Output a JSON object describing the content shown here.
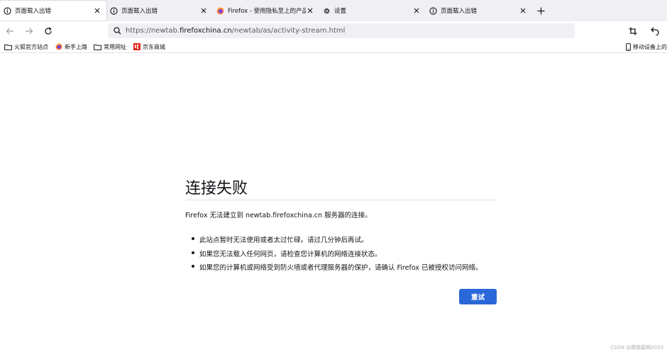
{
  "tabs": [
    {
      "title": "页面载入出错",
      "icon": "info-icon",
      "active": true
    },
    {
      "title": "页面载入出错",
      "icon": "info-icon",
      "active": false
    },
    {
      "title": "Firefox - 使用隐私至上的产品保护",
      "icon": "firefox-icon",
      "active": false
    },
    {
      "title": "设置",
      "icon": "gear-icon",
      "active": false
    },
    {
      "title": "页面载入出错",
      "icon": "info-icon",
      "active": false
    }
  ],
  "url": {
    "prefix": "https://newtab.",
    "host": "firefoxchina.cn",
    "path": "/newtab/as/activity-stream.html"
  },
  "bookmarks": {
    "items": [
      {
        "label": "火狐官方站点",
        "icon": "folder-icon"
      },
      {
        "label": "新手上路",
        "icon": "firefox-icon"
      },
      {
        "label": "常用网址",
        "icon": "folder-icon"
      },
      {
        "label": "京东商城",
        "icon": "jd-logo-icon"
      }
    ],
    "mobile": "移动设备上的"
  },
  "error": {
    "title": "连接失败",
    "description": "Firefox 无法建立到 newtab.firefoxchina.cn 服务器的连接。",
    "items": [
      "此站点暂时无法使用或者太过忙碌。请过几分钟后再试。",
      "如果您无法载入任何网页，请检查您计算机的网络连接状态。",
      "如果您的计算机或网络受到防火墙或者代理服务器的保护，请确认 Firefox 已被授权访问网络。"
    ],
    "retry_label": "重试"
  },
  "watermark": "CSDN @摩踏载畸2020",
  "colors": {
    "accent": "#2a67d8",
    "tabstrip": "#f0f0f4"
  }
}
